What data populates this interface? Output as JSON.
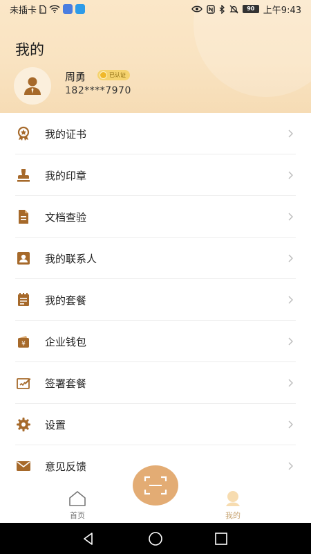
{
  "status_bar": {
    "carrier": "未插卡",
    "time": "上午9:43",
    "battery": "90"
  },
  "page_title": "我的",
  "user": {
    "name": "周勇",
    "verified_badge": "已认证",
    "phone": "182****7970"
  },
  "menu": [
    {
      "label": "我的证书",
      "icon": "certificate-icon"
    },
    {
      "label": "我的印章",
      "icon": "stamp-icon"
    },
    {
      "label": "文档查验",
      "icon": "document-icon"
    },
    {
      "label": "我的联系人",
      "icon": "contact-icon"
    },
    {
      "label": "我的套餐",
      "icon": "package-icon"
    },
    {
      "label": "企业钱包",
      "icon": "wallet-icon"
    },
    {
      "label": "签署套餐",
      "icon": "sign-package-icon"
    },
    {
      "label": "设置",
      "icon": "gear-icon"
    },
    {
      "label": "意见反馈",
      "icon": "mail-icon"
    }
  ],
  "tabs": {
    "home": "首页",
    "mine": "我的"
  },
  "colors": {
    "accent": "#a6692a",
    "scan_button": "#e3ac74",
    "header_bg": "#f9e3c1",
    "active_tab": "#c8a574"
  }
}
